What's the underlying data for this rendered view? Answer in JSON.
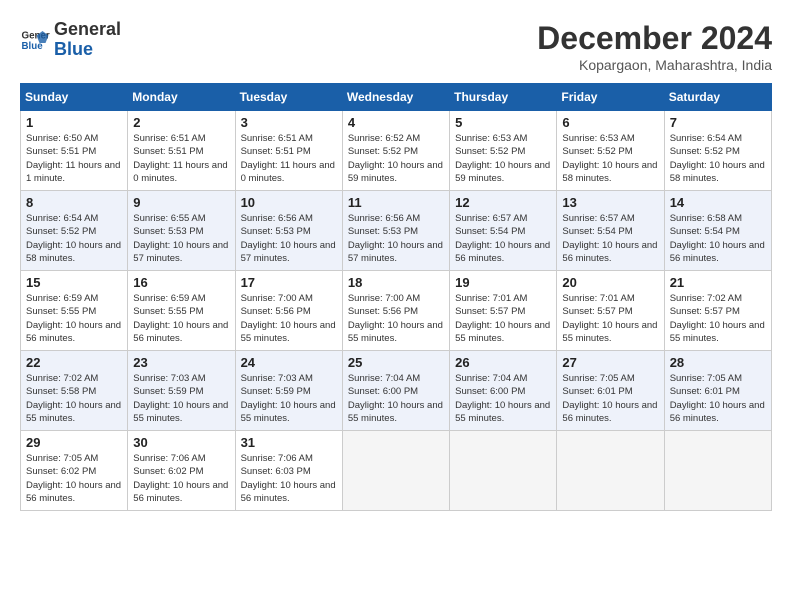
{
  "header": {
    "logo_line1": "General",
    "logo_line2": "Blue",
    "month_title": "December 2024",
    "location": "Kopargaon, Maharashtra, India"
  },
  "calendar": {
    "days_of_week": [
      "Sunday",
      "Monday",
      "Tuesday",
      "Wednesday",
      "Thursday",
      "Friday",
      "Saturday"
    ],
    "weeks": [
      [
        {
          "day": "",
          "empty": true
        },
        {
          "day": "",
          "empty": true
        },
        {
          "day": "",
          "empty": true
        },
        {
          "day": "",
          "empty": true
        },
        {
          "day": "",
          "empty": true
        },
        {
          "day": "",
          "empty": true
        },
        {
          "day": "",
          "empty": true
        }
      ],
      [
        {
          "num": "1",
          "sunrise": "6:50 AM",
          "sunset": "5:51 PM",
          "daylight": "11 hours and 1 minute."
        },
        {
          "num": "2",
          "sunrise": "6:51 AM",
          "sunset": "5:51 PM",
          "daylight": "11 hours and 0 minutes."
        },
        {
          "num": "3",
          "sunrise": "6:51 AM",
          "sunset": "5:51 PM",
          "daylight": "11 hours and 0 minutes."
        },
        {
          "num": "4",
          "sunrise": "6:52 AM",
          "sunset": "5:52 PM",
          "daylight": "10 hours and 59 minutes."
        },
        {
          "num": "5",
          "sunrise": "6:53 AM",
          "sunset": "5:52 PM",
          "daylight": "10 hours and 59 minutes."
        },
        {
          "num": "6",
          "sunrise": "6:53 AM",
          "sunset": "5:52 PM",
          "daylight": "10 hours and 58 minutes."
        },
        {
          "num": "7",
          "sunrise": "6:54 AM",
          "sunset": "5:52 PM",
          "daylight": "10 hours and 58 minutes."
        }
      ],
      [
        {
          "num": "8",
          "sunrise": "6:54 AM",
          "sunset": "5:52 PM",
          "daylight": "10 hours and 58 minutes."
        },
        {
          "num": "9",
          "sunrise": "6:55 AM",
          "sunset": "5:53 PM",
          "daylight": "10 hours and 57 minutes."
        },
        {
          "num": "10",
          "sunrise": "6:56 AM",
          "sunset": "5:53 PM",
          "daylight": "10 hours and 57 minutes."
        },
        {
          "num": "11",
          "sunrise": "6:56 AM",
          "sunset": "5:53 PM",
          "daylight": "10 hours and 57 minutes."
        },
        {
          "num": "12",
          "sunrise": "6:57 AM",
          "sunset": "5:54 PM",
          "daylight": "10 hours and 56 minutes."
        },
        {
          "num": "13",
          "sunrise": "6:57 AM",
          "sunset": "5:54 PM",
          "daylight": "10 hours and 56 minutes."
        },
        {
          "num": "14",
          "sunrise": "6:58 AM",
          "sunset": "5:54 PM",
          "daylight": "10 hours and 56 minutes."
        }
      ],
      [
        {
          "num": "15",
          "sunrise": "6:59 AM",
          "sunset": "5:55 PM",
          "daylight": "10 hours and 56 minutes."
        },
        {
          "num": "16",
          "sunrise": "6:59 AM",
          "sunset": "5:55 PM",
          "daylight": "10 hours and 56 minutes."
        },
        {
          "num": "17",
          "sunrise": "7:00 AM",
          "sunset": "5:56 PM",
          "daylight": "10 hours and 55 minutes."
        },
        {
          "num": "18",
          "sunrise": "7:00 AM",
          "sunset": "5:56 PM",
          "daylight": "10 hours and 55 minutes."
        },
        {
          "num": "19",
          "sunrise": "7:01 AM",
          "sunset": "5:57 PM",
          "daylight": "10 hours and 55 minutes."
        },
        {
          "num": "20",
          "sunrise": "7:01 AM",
          "sunset": "5:57 PM",
          "daylight": "10 hours and 55 minutes."
        },
        {
          "num": "21",
          "sunrise": "7:02 AM",
          "sunset": "5:57 PM",
          "daylight": "10 hours and 55 minutes."
        }
      ],
      [
        {
          "num": "22",
          "sunrise": "7:02 AM",
          "sunset": "5:58 PM",
          "daylight": "10 hours and 55 minutes."
        },
        {
          "num": "23",
          "sunrise": "7:03 AM",
          "sunset": "5:59 PM",
          "daylight": "10 hours and 55 minutes."
        },
        {
          "num": "24",
          "sunrise": "7:03 AM",
          "sunset": "5:59 PM",
          "daylight": "10 hours and 55 minutes."
        },
        {
          "num": "25",
          "sunrise": "7:04 AM",
          "sunset": "6:00 PM",
          "daylight": "10 hours and 55 minutes."
        },
        {
          "num": "26",
          "sunrise": "7:04 AM",
          "sunset": "6:00 PM",
          "daylight": "10 hours and 55 minutes."
        },
        {
          "num": "27",
          "sunrise": "7:05 AM",
          "sunset": "6:01 PM",
          "daylight": "10 hours and 56 minutes."
        },
        {
          "num": "28",
          "sunrise": "7:05 AM",
          "sunset": "6:01 PM",
          "daylight": "10 hours and 56 minutes."
        }
      ],
      [
        {
          "num": "29",
          "sunrise": "7:05 AM",
          "sunset": "6:02 PM",
          "daylight": "10 hours and 56 minutes."
        },
        {
          "num": "30",
          "sunrise": "7:06 AM",
          "sunset": "6:02 PM",
          "daylight": "10 hours and 56 minutes."
        },
        {
          "num": "31",
          "sunrise": "7:06 AM",
          "sunset": "6:03 PM",
          "daylight": "10 hours and 56 minutes."
        },
        {
          "empty": true
        },
        {
          "empty": true
        },
        {
          "empty": true
        },
        {
          "empty": true
        }
      ]
    ]
  }
}
